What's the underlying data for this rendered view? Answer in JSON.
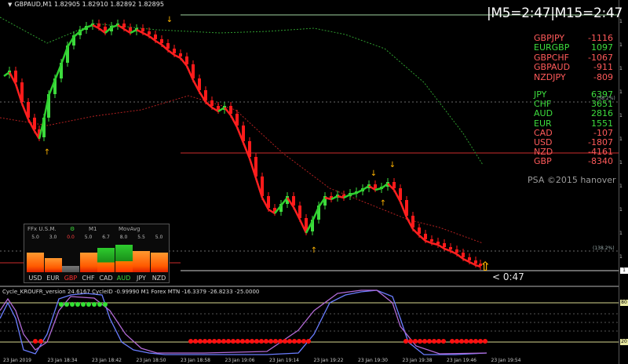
{
  "chart_title": "GBPAUD,M1  1.82905 1.82910 1.82892 1.82895",
  "timer_text": "|M5=2:47|M15=2:47",
  "pairs": [
    {
      "name": "GBPJPY",
      "value": "-1116",
      "color": "#ff5a5a"
    },
    {
      "name": "EURGBP",
      "value": "1097",
      "color": "#3ddc3d"
    },
    {
      "name": "GBPCHF",
      "value": "-1067",
      "color": "#ff5a5a"
    },
    {
      "name": "GBPAUD",
      "value": "-911",
      "color": "#ff5a5a"
    },
    {
      "name": "NZDJPY",
      "value": "-809",
      "color": "#ff5a5a"
    }
  ],
  "currencies": [
    {
      "name": "JPY",
      "value": "6397",
      "color": "#3ddc3d"
    },
    {
      "name": "CHF",
      "value": "3651",
      "color": "#3ddc3d"
    },
    {
      "name": "AUD",
      "value": "2816",
      "color": "#3ddc3d"
    },
    {
      "name": "EUR",
      "value": "1551",
      "color": "#3ddc3d"
    },
    {
      "name": "CAD",
      "value": "-107",
      "color": "#ff5a5a"
    },
    {
      "name": "USD",
      "value": "-1807",
      "color": "#ff5a5a"
    },
    {
      "name": "NZD",
      "value": "-4161",
      "color": "#ff5a5a"
    },
    {
      "name": "GBP",
      "value": "-8340",
      "color": "#ff5a5a"
    }
  ],
  "copyright": "PSA ©2015 hanover",
  "countdown": "< 0:47",
  "pct_label_upper": "(38.2%)",
  "pct_label_lower": "(138.2%)",
  "indicator_label": "Cycle_KROUFR_version 24.6167  CycleID -0.99990  M1 Forex MTN  -16.3379 -26.8233 -25.0000",
  "indicator_levels": [
    "80",
    "20"
  ],
  "strength_panel": {
    "headers": [
      "FFx U.S.M.",
      "M1",
      "MovAvg"
    ],
    "values": [
      "5.0",
      "3.0",
      "0.0",
      "5.0",
      "6.7",
      "8.0",
      "5.5",
      "5.0"
    ],
    "currencies": [
      "USD",
      "EUR",
      "GBP",
      "CHF",
      "CAD",
      "AUD",
      "JPY",
      "NZD"
    ],
    "levels": [
      0.5,
      0.3,
      0.0,
      0.5,
      0.67,
      0.8,
      0.55,
      0.5
    ],
    "highlight_gbp_color": "#ff3030",
    "highlight_aud_color": "#3ddc3d"
  },
  "x_axis_ticks": [
    "23 Jan 2019",
    "23 Jan 18:34",
    "23 Jan 18:42",
    "23 Jan 18:50",
    "23 Jan 18:58",
    "23 Jan 19:06",
    "23 Jan 19:14",
    "23 Jan 19:22",
    "23 Jan 19:30",
    "23 Jan 19:38",
    "23 Jan 19:46",
    "23 Jan 19:54"
  ],
  "y_axis_labels": [
    "1",
    "1",
    "1",
    "1",
    "1",
    "1",
    "1",
    "1",
    "1",
    "1",
    "1",
    "1"
  ],
  "colors": {
    "bull": "#3ddc3d",
    "bear": "#ff1a1a",
    "ma_line": "#ff2020",
    "arrow": "#ffb400",
    "level_line": "#cc2b2b",
    "dots_red": "#ff1010",
    "dots_green": "#33e033"
  }
}
